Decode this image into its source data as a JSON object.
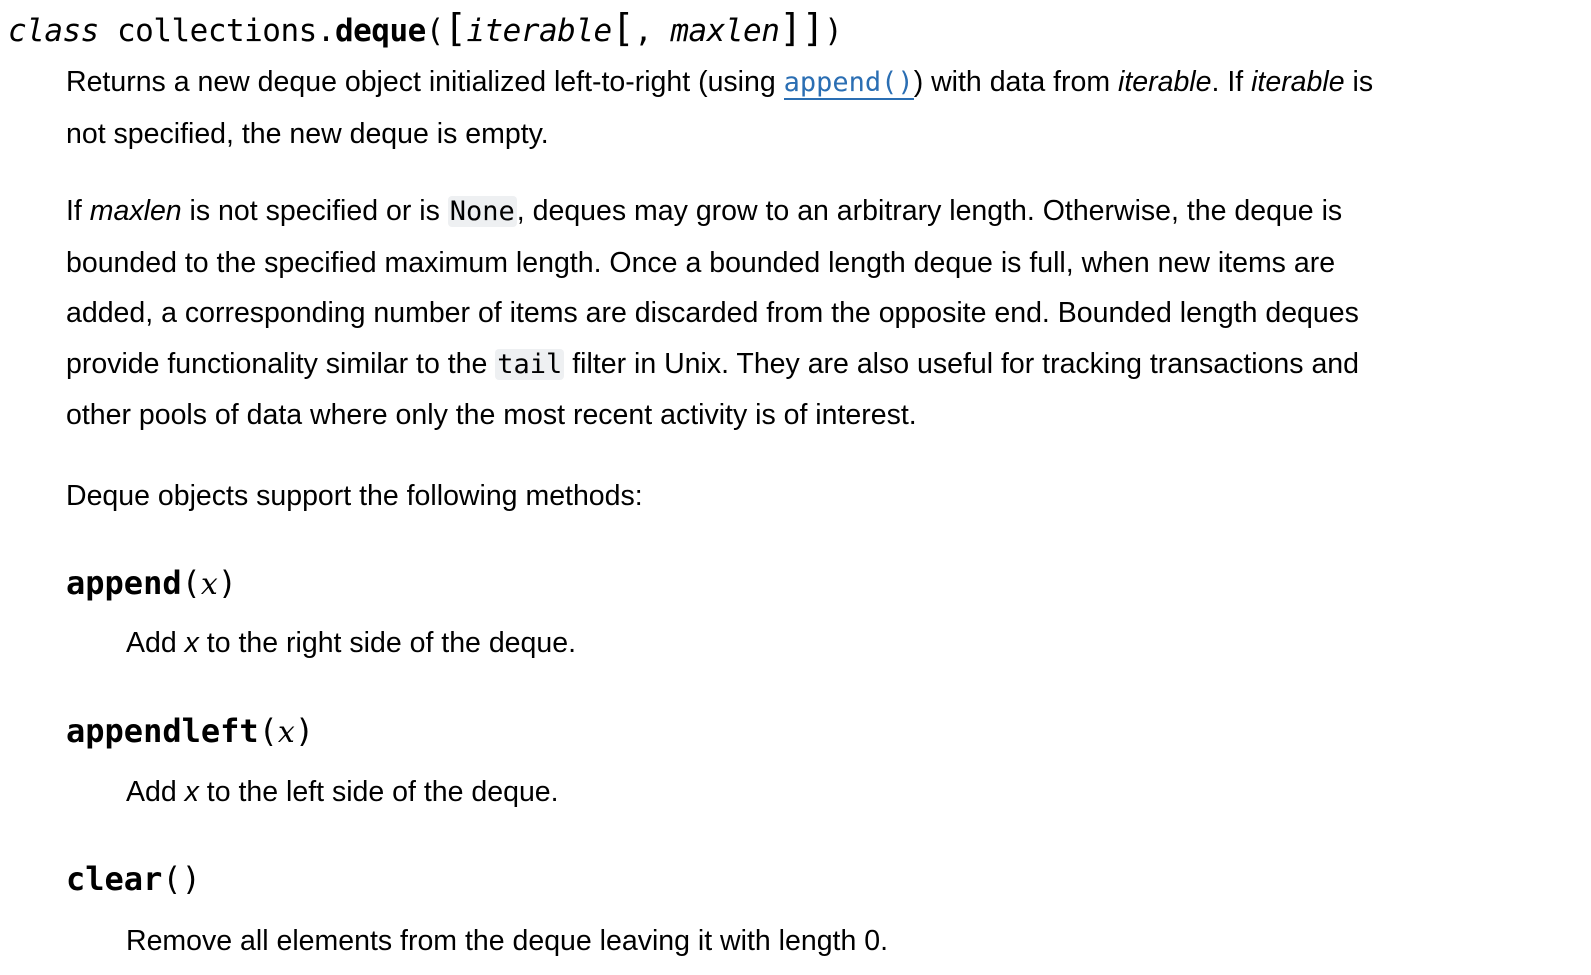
{
  "signature": {
    "keyword": "class",
    "module": "collections.",
    "name": "deque",
    "open": "(",
    "lb1": "[",
    "param1": "iterable",
    "lb2": "[",
    "comma": ", ",
    "param2": "maxlen",
    "rb": "]]",
    "close": ")"
  },
  "p1": {
    "t1": "Returns a new deque object initialized left-to-right (using ",
    "link": "append()",
    "t2": ") with data from ",
    "i1": "iterable",
    "t3": ". If ",
    "i2": "iterable",
    "t4": " is",
    "line2": "not specified, the new deque is empty."
  },
  "p2": {
    "t1": "If ",
    "i1": "maxlen",
    "t2": " is not specified or is ",
    "code1": "None",
    "t3": ", deques may grow to an arbitrary length. Otherwise, the deque is",
    "line2": "bounded to the specified maximum length. Once a bounded length deque is full, when new items are",
    "line3": "added, a corresponding number of items are discarded from the opposite end. Bounded length deques",
    "l4a": "provide functionality similar to the ",
    "code2": "tail",
    "l4b": " filter in Unix. They are also useful for tracking transactions and",
    "line5": "other pools of data where only the most recent activity is of interest."
  },
  "p3": "Deque objects support the following methods:",
  "methods": [
    {
      "name": "append",
      "open": "(",
      "arg": "x",
      "close": ")",
      "d1": "Add ",
      "darg": "x",
      "d2": " to the right side of the deque."
    },
    {
      "name": "appendleft",
      "open": "(",
      "arg": "x",
      "close": ")",
      "d1": "Add ",
      "darg": "x",
      "d2": " to the left side of the deque."
    },
    {
      "name": "clear",
      "open": "(",
      "arg": "",
      "close": ")",
      "d1": "Remove all elements from the deque leaving it with length 0.",
      "darg": "",
      "d2": ""
    }
  ]
}
